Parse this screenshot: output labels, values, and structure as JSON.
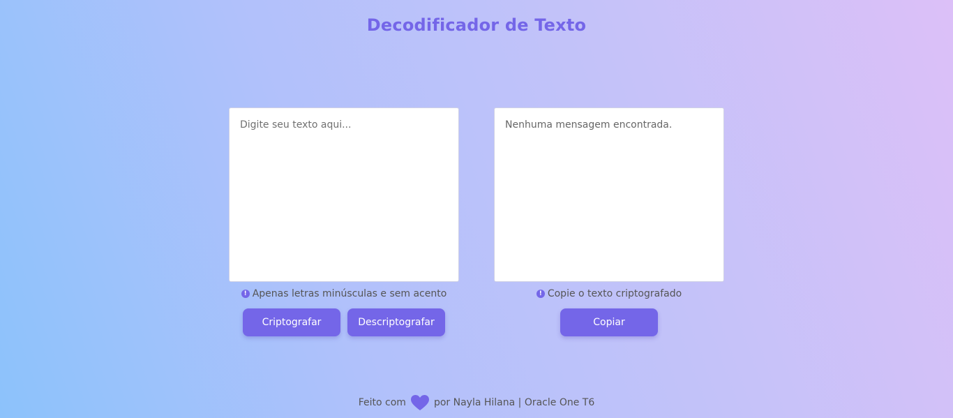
{
  "header": {
    "title": "Decodificador de Texto"
  },
  "input_panel": {
    "placeholder": "Digite seu texto aqui...",
    "hint_icon": "info-icon",
    "hint": "Apenas letras minúsculas e sem acento",
    "encrypt_label": "Criptografar",
    "decrypt_label": "Descriptografar"
  },
  "output_panel": {
    "message": "Nenhuma mensagem encontrada.",
    "hint_icon": "info-icon",
    "hint": "Copie o texto criptografado",
    "copy_label": "Copiar"
  },
  "footer": {
    "made_with": "Feito com",
    "heart_icon": "heart-icon",
    "credit": "por Nayla Hilana | Oracle One T6"
  },
  "colors": {
    "accent": "#7466e8",
    "gradient_start": "#8cc2fb",
    "gradient_end": "#dcc0f8"
  }
}
